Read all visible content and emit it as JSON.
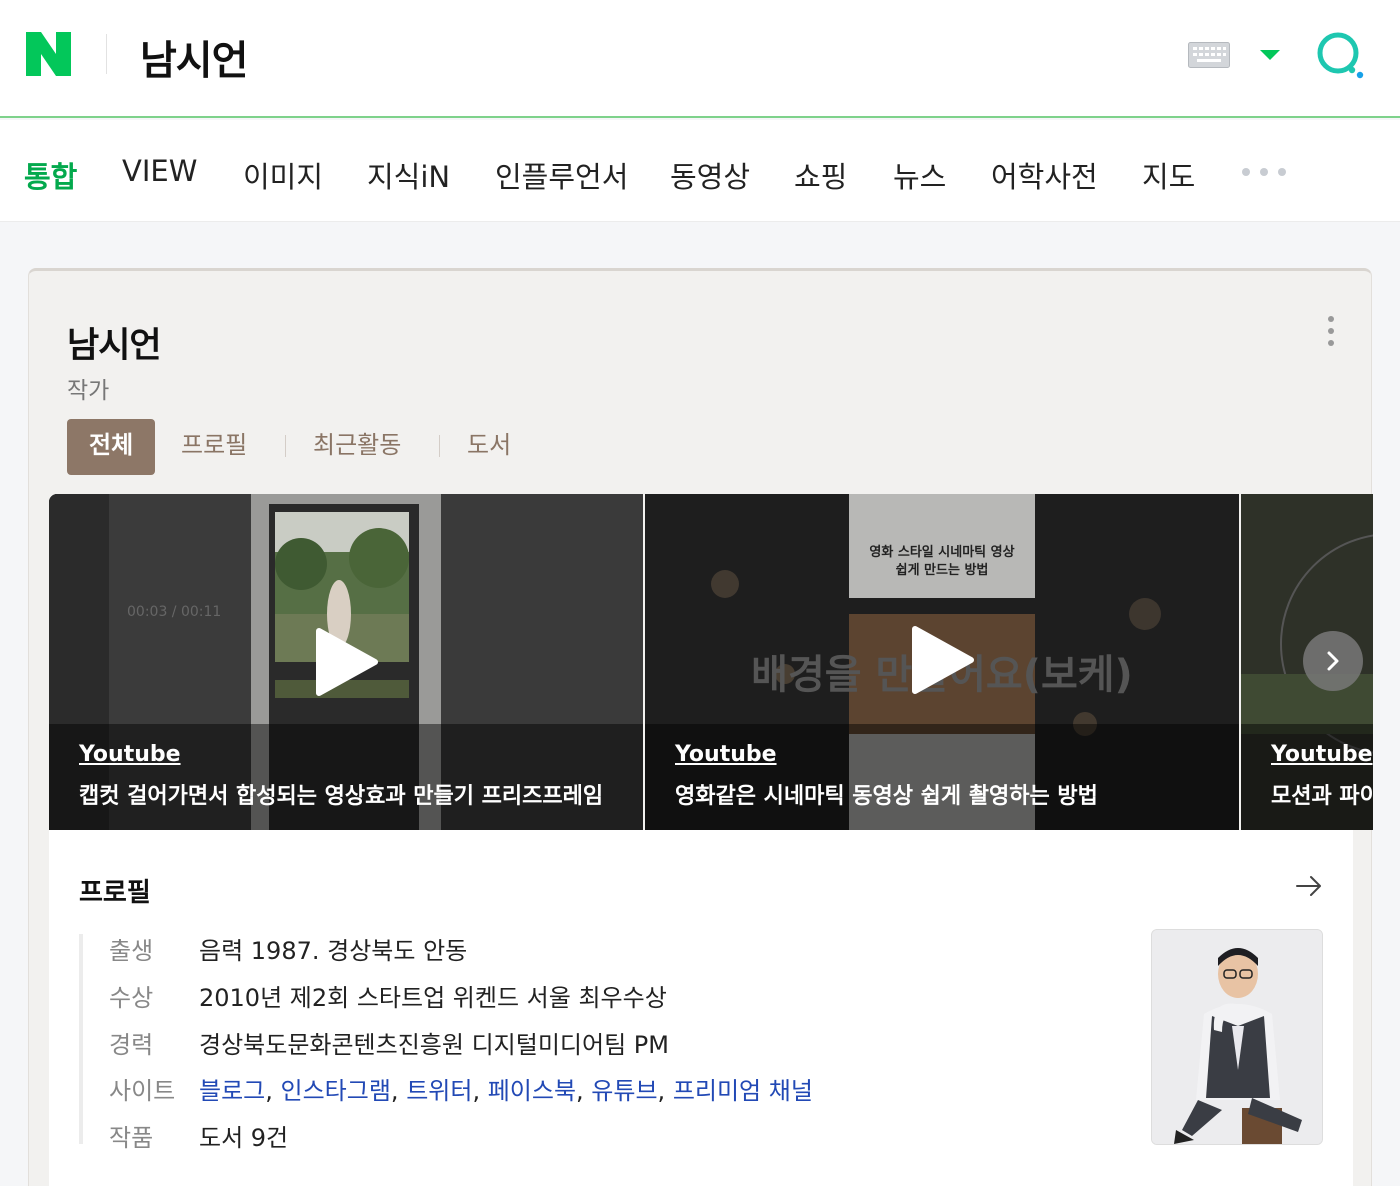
{
  "header": {
    "logo_icon": "naver-n-logo",
    "query": "남시언",
    "brand_color": "#03c75a",
    "icons": [
      "keyboard-icon",
      "dropdown-caret-icon",
      "search-icon"
    ]
  },
  "tabs": [
    {
      "label": "통합",
      "active": true
    },
    {
      "label": "VIEW"
    },
    {
      "label": "이미지"
    },
    {
      "label": "지식iN"
    },
    {
      "label": "인플루언서"
    },
    {
      "label": "동영상"
    },
    {
      "label": "쇼핑"
    },
    {
      "label": "뉴스"
    },
    {
      "label": "어학사전"
    },
    {
      "label": "지도"
    }
  ],
  "knowledge_panel": {
    "title": "남시언",
    "subtitle": "작가",
    "subtabs": [
      {
        "label": "전체",
        "active": true
      },
      {
        "label": "프로필"
      },
      {
        "label": "최근활동"
      },
      {
        "label": "도서"
      }
    ],
    "videos": [
      {
        "source": "Youtube",
        "title": "캡컷 걸어가면서 합성되는 영상효과 만들기 프리즈프레임",
        "overlay_text": "00:03 / 00:11"
      },
      {
        "source": "Youtube",
        "title": "영화같은 시네마틱 동영상 쉽게 촬영하는 방법",
        "overlay_top": "영화 스타일 시네마틱 영상\n쉽게 만드는 방법",
        "overlay_big": "배경을 만들어요(보케)"
      },
      {
        "source": "Youtube",
        "title": "모션과 파이"
      }
    ],
    "profile": {
      "heading": "프로필",
      "rows": [
        {
          "label": "출생",
          "value": "음력 1987. 경상북도 안동"
        },
        {
          "label": "수상",
          "value": "2010년 제2회 스타트업 위켄드 서울 최우수상"
        },
        {
          "label": "경력",
          "value": "경상북도문화콘텐츠진흥원 디지털미디어팀 PM"
        },
        {
          "label": "사이트",
          "links": [
            "블로그",
            "인스타그램",
            "트위터",
            "페이스북",
            "유튜브",
            "프리미엄 채널"
          ]
        },
        {
          "label": "작품",
          "link": "도서 9건"
        }
      ]
    }
  }
}
